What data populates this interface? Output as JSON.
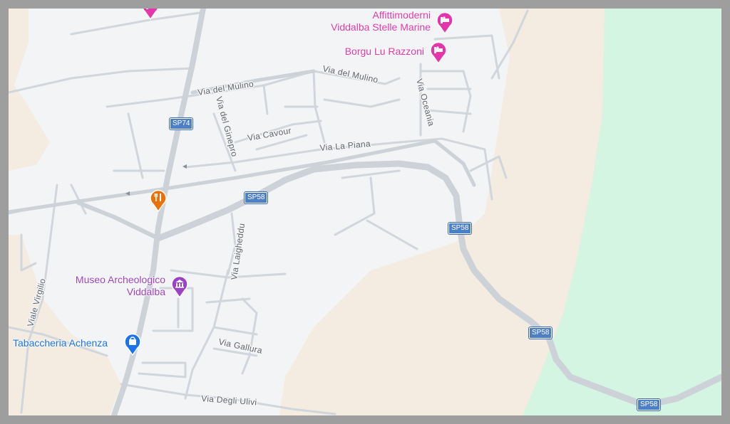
{
  "map": {
    "colors": {
      "land": "#f4ece0",
      "urban": "#f3f4f5",
      "water": "#d3f5e2",
      "road": "#d0d6dc",
      "border": "#9e9e9e",
      "label": "#5f6670",
      "shield": "#4d7fc4",
      "lodging": "#e535ab",
      "museum": "#9c42c4",
      "shop": "#1a73e8",
      "food": "#e8710a"
    },
    "streets": {
      "via_del_mulino_1": "Via del Mulino",
      "via_del_mulino_2": "Via del Mulino",
      "via_oceania": "Via Oceania",
      "via_del_ginepro": "Via del Ginepro",
      "via_cavour": "Via Cavour",
      "via_la_piana": "Via La Piana",
      "via_laigheddu": "Via Laigheddu",
      "viale_virgilio": "Viale Virgilio",
      "via_gallura": "Via Gallura",
      "via_degli_ulivi": "Via Degli Ulivi"
    },
    "shields": {
      "sp74": "SP74",
      "sp58_a": "SP58",
      "sp58_b": "SP58",
      "sp58_c": "SP58",
      "sp58_d": "SP58"
    },
    "pois": [
      {
        "label_line1": "Affittimoderni",
        "label_line2": "Viddalba Stelle Marine",
        "icon": "hotel-icon",
        "category": "lodging"
      },
      {
        "label": "Borgu Lu Razzoni",
        "icon": "hotel-icon",
        "category": "lodging"
      },
      {
        "label_line1": "Museo Archeologico",
        "label_line2": "Viddalba",
        "icon": "museum-icon",
        "category": "museum"
      },
      {
        "label": "Tabaccheria Achenza",
        "icon": "shopping-bag-icon",
        "category": "shop"
      },
      {
        "label": "",
        "icon": "restaurant-icon",
        "category": "food"
      },
      {
        "label": "",
        "icon": "hotel-icon",
        "category": "lodging"
      }
    ]
  }
}
